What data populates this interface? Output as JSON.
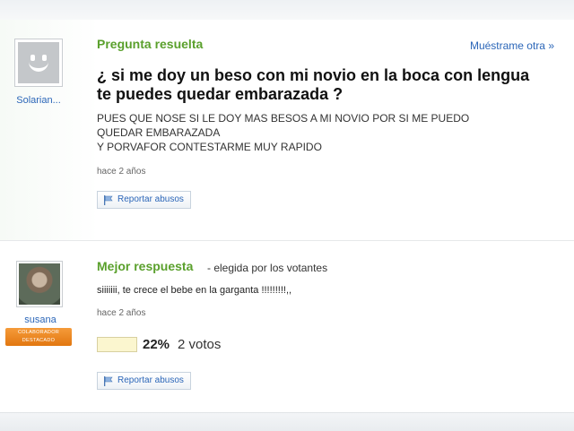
{
  "question": {
    "status_label": "Pregunta resuelta",
    "show_other_label": "Muéstrame otra »",
    "user_name": "Solarian...",
    "title": "¿ si me doy un beso con mi novio en la boca con lengua te puedes quedar embarazada ?",
    "body_lines": [
      "PUES QUE NOSE SI LE DOY MAS BESOS A MI NOVIO POR SI ME PUEDO",
      "QUEDAR EMBARAZADA",
      "Y PORVAFOR CONTESTARME MUY RAPIDO"
    ],
    "timestamp": "hace 2 años",
    "report_label": "Reportar abusos",
    "avatar_icon": "smiley-placeholder-icon"
  },
  "best_answer": {
    "label": "Mejor respuesta",
    "chosen_by": "- elegida por los votantes",
    "user_name": "susana",
    "badge_lines": [
      "COLABORADOR",
      "DESTACADO"
    ],
    "text": "siiiiiii, te crece el bebe en la garganta !!!!!!!!!,,",
    "timestamp": "hace 2 años",
    "vote_percent_label": "22%",
    "vote_fraction": 0.22,
    "vote_count_label": "2 votos",
    "report_label": "Reportar abusos"
  },
  "colors": {
    "section_title": "#5aa02c",
    "link": "#2b66b8",
    "badge": "#f08a24"
  }
}
